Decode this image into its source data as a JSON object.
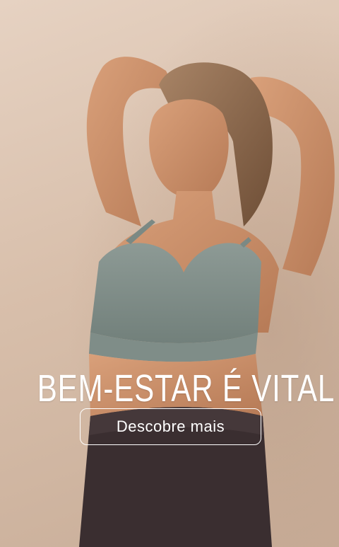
{
  "hero": {
    "image_alt": "woman in sage sports bra leaning against wall",
    "headline": "BEM-ESTAR É VITAL",
    "cta_label": "Descobre mais"
  }
}
